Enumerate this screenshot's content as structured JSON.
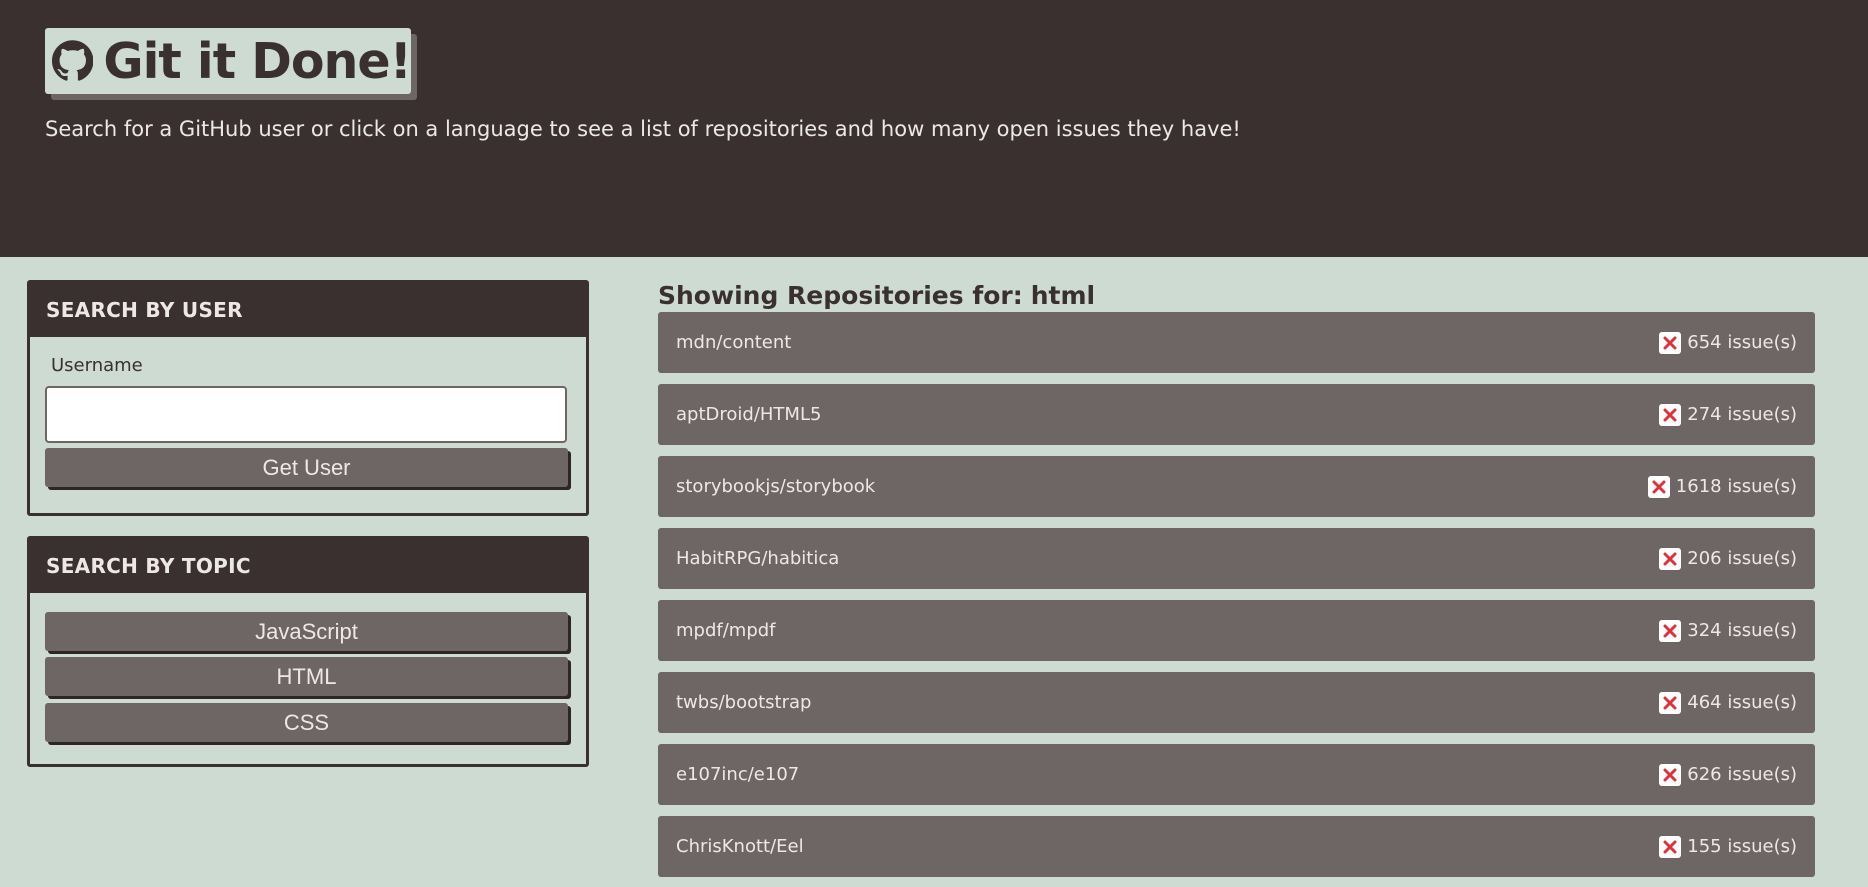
{
  "header": {
    "title": "Git it Done!",
    "logo_icon": "github-icon",
    "subtitle": "Search for a GitHub user or click on a language to see a list of repositories and how many open issues they have!"
  },
  "user_search": {
    "heading": "SEARCH BY USER",
    "username_label": "Username",
    "username_value": "",
    "button_label": "Get User"
  },
  "topic_search": {
    "heading": "SEARCH BY TOPIC",
    "topics": [
      "JavaScript",
      "HTML",
      "CSS"
    ]
  },
  "results": {
    "title_prefix": "Showing Repositories for:",
    "search_term": "html",
    "status_icon": "x-icon",
    "repos": [
      {
        "name": "mdn/content",
        "issues": "654 issue(s)"
      },
      {
        "name": "aptDroid/HTML5",
        "issues": "274 issue(s)"
      },
      {
        "name": "storybookjs/storybook",
        "issues": "1618 issue(s)"
      },
      {
        "name": "HabitRPG/habitica",
        "issues": "206 issue(s)"
      },
      {
        "name": "mpdf/mpdf",
        "issues": "324 issue(s)"
      },
      {
        "name": "twbs/bootstrap",
        "issues": "464 issue(s)"
      },
      {
        "name": "e107inc/e107",
        "issues": "626 issue(s)"
      },
      {
        "name": "ChrisKnott/Eel",
        "issues": "155 issue(s)"
      }
    ]
  },
  "colors": {
    "header_bg": "#3a3030",
    "page_bg": "#cddbd2",
    "item_bg": "#6e6664",
    "status_red": "#e0313a"
  }
}
